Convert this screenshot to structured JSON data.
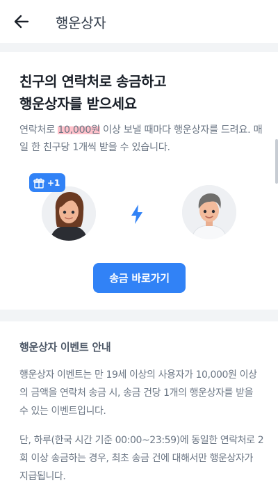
{
  "header": {
    "title": "행운상자",
    "back_icon": "arrow-left-icon"
  },
  "promo": {
    "headline_line1": "친구의 연락처로 송금하고",
    "headline_line2": "행운상자를 받으세요",
    "desc_prefix": "연락처로 ",
    "desc_highlight": "10,000원",
    "desc_suffix": " 이상 보낼 때마다 행운상자를 드려요. 매일 한 친구당 1개씩 받을 수 있습니다.",
    "badge_count": "+1",
    "badge_icon": "gift-icon",
    "connector_icon": "lightning-bolt-icon",
    "send_button_label": "송금 바로가기"
  },
  "info": {
    "title": "행운상자 이벤트 안내",
    "paragraph1": "행운상자 이벤트는 만 19세 이상의 사용자가 10,000원 이상의 금액을 연락처 송금 시, 송금 건당 1개의 행운상자를 받을 수 있는 이벤트입니다.",
    "paragraph2": "단, 하루(한국 시간 기준 00:00~23:59)에 동일한 연락처로 2회 이상 송금하는 경우, 최초 송금 건에 대해서만 행운상자가 지급됩니다."
  },
  "colors": {
    "accent": "#3182f6",
    "highlight": "#ff7890",
    "background": "#f2f4f6"
  }
}
